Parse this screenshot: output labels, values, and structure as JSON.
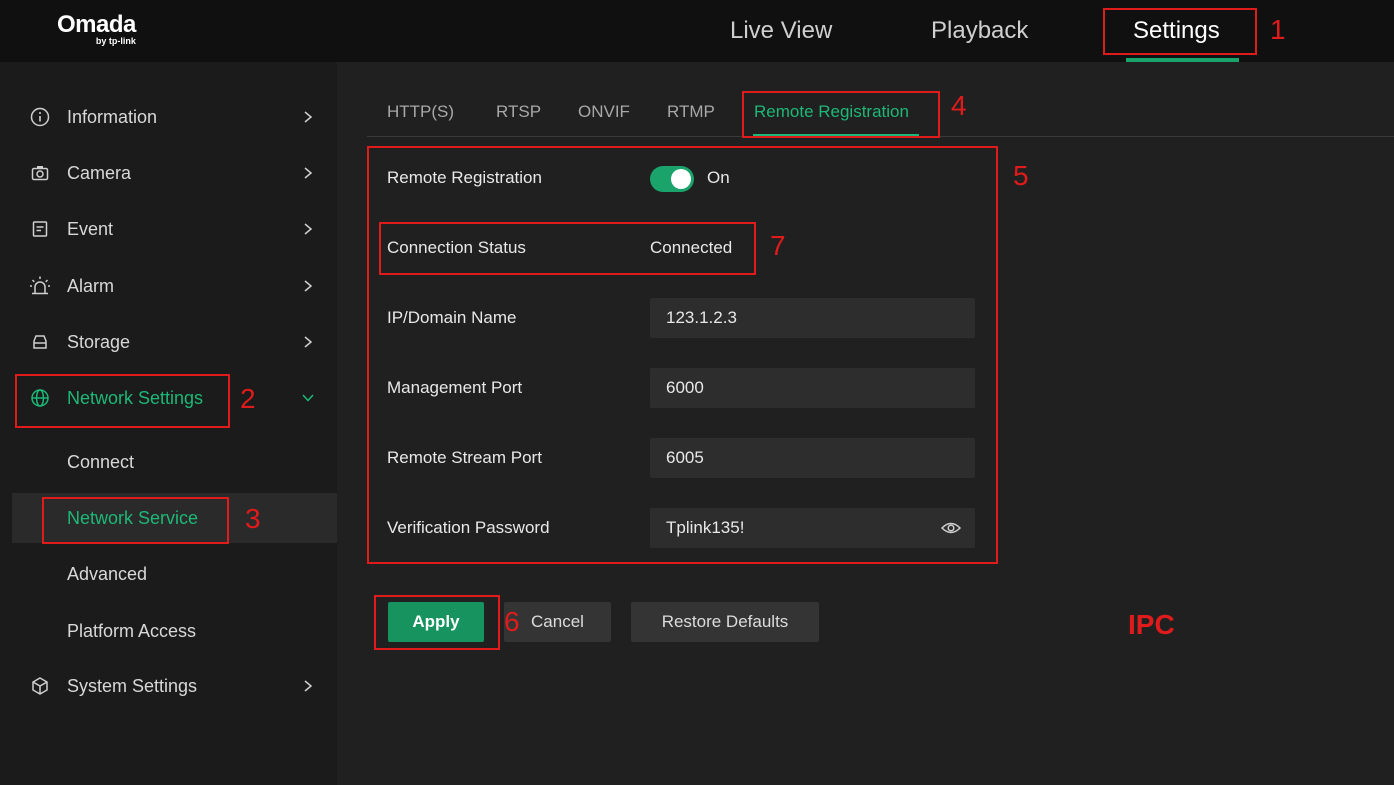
{
  "header": {
    "logo_main": "Omada",
    "logo_sub": "by tp-link",
    "nav": [
      "Live View",
      "Playback",
      "Settings"
    ]
  },
  "sidebar": {
    "items": [
      {
        "label": "Information",
        "icon": "info-icon"
      },
      {
        "label": "Camera",
        "icon": "camera-icon"
      },
      {
        "label": "Event",
        "icon": "event-icon"
      },
      {
        "label": "Alarm",
        "icon": "alarm-icon"
      },
      {
        "label": "Storage",
        "icon": "storage-icon"
      },
      {
        "label": "Network Settings",
        "icon": "globe-icon"
      },
      {
        "label": "System Settings",
        "icon": "cube-icon"
      }
    ],
    "subitems": [
      "Connect",
      "Network Service",
      "Advanced",
      "Platform Access"
    ]
  },
  "tabs": [
    "HTTP(S)",
    "RTSP",
    "ONVIF",
    "RTMP",
    "Remote Registration"
  ],
  "form": {
    "remote_registration_label": "Remote Registration",
    "remote_registration_state": "On",
    "connection_status_label": "Connection Status",
    "connection_status_value": "Connected",
    "ip_label": "IP/Domain Name",
    "ip_value": "123.1.2.3",
    "mgmt_port_label": "Management Port",
    "mgmt_port_value": "6000",
    "stream_port_label": "Remote Stream Port",
    "stream_port_value": "6005",
    "password_label": "Verification Password",
    "password_value": "Tplink135!"
  },
  "buttons": {
    "apply": "Apply",
    "cancel": "Cancel",
    "restore": "Restore Defaults"
  },
  "annotations": {
    "n1": "1",
    "n2": "2",
    "n3": "3",
    "n4": "4",
    "n5": "5",
    "n6": "6",
    "n7": "7",
    "ipc": "IPC"
  },
  "colors": {
    "accent": "#1db877",
    "annotation": "#e01b1b"
  }
}
